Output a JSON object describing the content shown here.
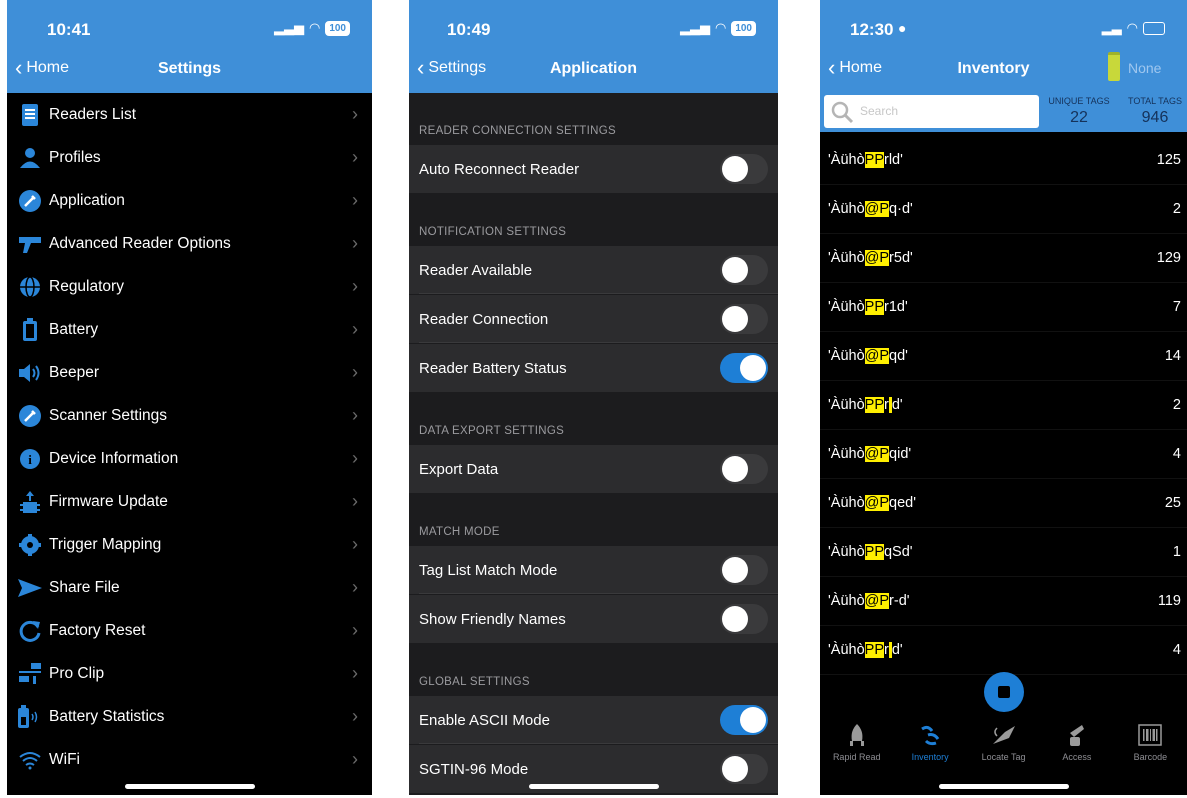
{
  "settings": {
    "time": "10:41",
    "battery": "100",
    "back_label": "Home",
    "title": "Settings",
    "items": [
      {
        "label": "Readers List",
        "icon": "readers-list-icon"
      },
      {
        "label": "Profiles",
        "icon": "profiles-icon"
      },
      {
        "label": "Application",
        "icon": "application-icon"
      },
      {
        "label": "Advanced Reader Options",
        "icon": "advanced-reader-icon"
      },
      {
        "label": "Regulatory",
        "icon": "globe-icon"
      },
      {
        "label": "Battery",
        "icon": "battery-icon"
      },
      {
        "label": "Beeper",
        "icon": "speaker-icon"
      },
      {
        "label": "Scanner Settings",
        "icon": "wrench-icon"
      },
      {
        "label": "Device Information",
        "icon": "info-icon"
      },
      {
        "label": "Firmware Update",
        "icon": "firmware-icon"
      },
      {
        "label": "Trigger Mapping",
        "icon": "trigger-icon"
      },
      {
        "label": "Share File",
        "icon": "share-icon"
      },
      {
        "label": "Factory Reset",
        "icon": "reset-icon"
      },
      {
        "label": "Pro Clip",
        "icon": "pro-clip-icon"
      },
      {
        "label": "Battery Statistics",
        "icon": "battery-stats-icon"
      },
      {
        "label": "WiFi",
        "icon": "wifi-icon"
      }
    ]
  },
  "application": {
    "time": "10:49",
    "battery": "100",
    "back_label": "Settings",
    "title": "Application",
    "sections": [
      {
        "header": "READER CONNECTION SETTINGS",
        "rows": [
          {
            "label": "Auto Reconnect Reader",
            "on": false
          }
        ]
      },
      {
        "header": "NOTIFICATION SETTINGS",
        "rows": [
          {
            "label": "Reader Available",
            "on": false
          },
          {
            "label": "Reader Connection",
            "on": false
          },
          {
            "label": "Reader Battery Status",
            "on": true
          }
        ]
      },
      {
        "header": "DATA EXPORT SETTINGS",
        "rows": [
          {
            "label": "Export Data",
            "on": false
          }
        ]
      },
      {
        "header": "MATCH MODE",
        "rows": [
          {
            "label": "Tag List Match Mode",
            "on": false
          },
          {
            "label": "Show Friendly Names",
            "on": false
          }
        ]
      },
      {
        "header": "GLOBAL SETTINGS",
        "rows": [
          {
            "label": "Enable ASCII Mode",
            "on": true
          },
          {
            "label": "SGTIN-96 Mode",
            "on": false
          }
        ]
      }
    ]
  },
  "inventory": {
    "time": "12:30",
    "back_label": "Home",
    "title": "Inventory",
    "battery_label": "None",
    "search_placeholder": "Search",
    "unique_tags_label": "UNIQUE TAGS",
    "unique_tags": "22",
    "total_tags_label": "TOTAL TAGS",
    "total_tags": "946",
    "tags": [
      {
        "prefix": "'Àühò",
        "hl1": "P",
        "hl2": "P",
        "mid": "",
        "suffix": "rld'",
        "count": "125"
      },
      {
        "prefix": "'Àühò",
        "hl1": "@",
        "hl2": "P",
        "mid": "",
        "suffix": "q·d'",
        "count": "2"
      },
      {
        "prefix": "'Àühò",
        "hl1": "@",
        "hl2": "P",
        "mid": "",
        "suffix": "r5d'",
        "count": "129"
      },
      {
        "prefix": "'Àühò",
        "hl1": "P",
        "hl2": "P",
        "mid": "",
        "suffix": "r1d'",
        "count": "7"
      },
      {
        "prefix": "'Àühò",
        "hl1": "@",
        "hl2": "P",
        "mid": "",
        "suffix": "qd'",
        "count": "14"
      },
      {
        "prefix": "'Àühò",
        "hl1": "P",
        "hl2": "P",
        "mid": "r",
        "suffix": "d'",
        "count": "2"
      },
      {
        "prefix": "'Àühò",
        "hl1": "@",
        "hl2": "P",
        "mid": "",
        "suffix": "qid'",
        "count": "4"
      },
      {
        "prefix": "'Àühò",
        "hl1": "@",
        "hl2": "P",
        "mid": "",
        "suffix": "qed'",
        "count": "25"
      },
      {
        "prefix": "'Àühò",
        "hl1": "P",
        "hl2": "P",
        "mid": "",
        "suffix": "qSd'",
        "count": "1"
      },
      {
        "prefix": "'Àühò",
        "hl1": "@",
        "hl2": "P",
        "mid": "",
        "suffix": "r-d'",
        "count": "119"
      },
      {
        "prefix": "'Àühò",
        "hl1": "P",
        "hl2": "P",
        "mid": "r",
        "suffix": "d'",
        "count": "4"
      }
    ],
    "tabs": [
      {
        "label": "Rapid Read",
        "icon": "rapid-read-icon",
        "active": false
      },
      {
        "label": "Inventory",
        "icon": "inventory-icon",
        "active": true
      },
      {
        "label": "Locate Tag",
        "icon": "locate-tag-icon",
        "active": false
      },
      {
        "label": "Access",
        "icon": "access-icon",
        "active": false
      },
      {
        "label": "Barcode",
        "icon": "barcode-icon",
        "active": false
      }
    ]
  }
}
